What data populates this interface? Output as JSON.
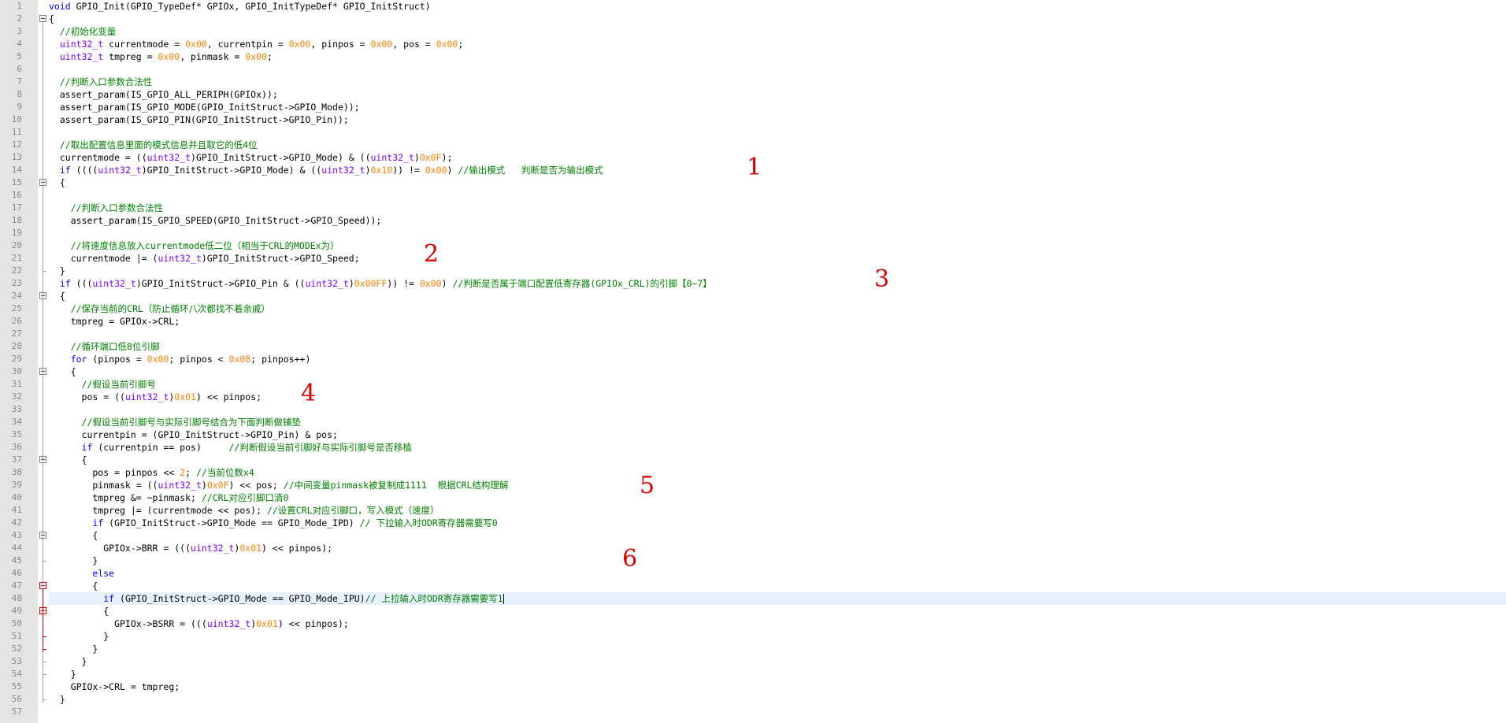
{
  "editor": {
    "lines": [
      {
        "n": "1",
        "html": "<span class=\"kw\">void</span> GPIO_Init(GPIO_TypeDef* GPIOx, GPIO_InitTypeDef* GPIO_InitStruct)"
      },
      {
        "n": "2",
        "html": "{"
      },
      {
        "n": "3",
        "html": "  <span class=\"cm\">//初始化变量</span>"
      },
      {
        "n": "4",
        "html": "  <span class=\"ty\">uint32_t</span> currentmode = <span class=\"num\">0x00</span>, currentpin = <span class=\"num\">0x00</span>, pinpos = <span class=\"num\">0x00</span>, pos = <span class=\"num\">0x00</span>;"
      },
      {
        "n": "5",
        "html": "  <span class=\"ty\">uint32_t</span> tmpreg = <span class=\"num\">0x00</span>, pinmask = <span class=\"num\">0x00</span>;"
      },
      {
        "n": "6",
        "html": ""
      },
      {
        "n": "7",
        "html": "  <span class=\"cm\">//判断入口参数合法性</span>"
      },
      {
        "n": "8",
        "html": "  assert_param(IS_GPIO_ALL_PERIPH(GPIOx));"
      },
      {
        "n": "9",
        "html": "  assert_param(IS_GPIO_MODE(GPIO_InitStruct-&gt;GPIO_Mode));"
      },
      {
        "n": "10",
        "html": "  assert_param(IS_GPIO_PIN(GPIO_InitStruct-&gt;GPIO_Pin));"
      },
      {
        "n": "11",
        "html": ""
      },
      {
        "n": "12",
        "html": "  <span class=\"cm\">//取出配置信息里面的模式信息并且取它的低4位</span>"
      },
      {
        "n": "13",
        "html": "  currentmode = ((<span class=\"ty\">uint32_t</span>)GPIO_InitStruct-&gt;GPIO_Mode) &amp; ((<span class=\"ty\">uint32_t</span>)<span class=\"num\">0x0F</span>);"
      },
      {
        "n": "14",
        "html": "  <span class=\"kw\">if</span> ((((<span class=\"ty\">uint32_t</span>)GPIO_InitStruct-&gt;GPIO_Mode) &amp; ((<span class=\"ty\">uint32_t</span>)<span class=\"num\">0x10</span>)) != <span class=\"num\">0x00</span>) <span class=\"cm\">//输出模式   判断是否为输出模式</span>"
      },
      {
        "n": "15",
        "html": "  {"
      },
      {
        "n": "16",
        "html": ""
      },
      {
        "n": "17",
        "html": "    <span class=\"cm\">//判断入口参数合法性</span>"
      },
      {
        "n": "18",
        "html": "    assert_param(IS_GPIO_SPEED(GPIO_InitStruct-&gt;GPIO_Speed));"
      },
      {
        "n": "19",
        "html": ""
      },
      {
        "n": "20",
        "html": "    <span class=\"cm\">//将速度信息放入currentmode低二位（相当于CRL的MODEx为）</span>"
      },
      {
        "n": "21",
        "html": "    currentmode |= (<span class=\"ty\">uint32_t</span>)GPIO_InitStruct-&gt;GPIO_Speed;"
      },
      {
        "n": "22",
        "html": "  }"
      },
      {
        "n": "23",
        "html": "  <span class=\"kw\">if</span> (((<span class=\"ty\">uint32_t</span>)GPIO_InitStruct-&gt;GPIO_Pin &amp; ((<span class=\"ty\">uint32_t</span>)<span class=\"num\">0x00FF</span>)) != <span class=\"num\">0x00</span>) <span class=\"cm\">//判断是否属于端口配置低寄存器(GPIOx_CRL)的引脚【0~7】</span>"
      },
      {
        "n": "24",
        "html": "  {"
      },
      {
        "n": "25",
        "html": "    <span class=\"cm\">//保存当前的CRL（防止循环八次都找不着亲戚）</span>"
      },
      {
        "n": "26",
        "html": "    tmpreg = GPIOx-&gt;CRL;"
      },
      {
        "n": "27",
        "html": ""
      },
      {
        "n": "28",
        "html": "    <span class=\"cm\">//循环端口低8位引脚</span>"
      },
      {
        "n": "29",
        "html": "    <span class=\"kw\">for</span> (pinpos = <span class=\"num\">0x00</span>; pinpos &lt; <span class=\"num\">0x08</span>; pinpos++)"
      },
      {
        "n": "30",
        "html": "    {"
      },
      {
        "n": "31",
        "html": "      <span class=\"cm\">//假设当前引脚号</span>"
      },
      {
        "n": "32",
        "html": "      pos = ((<span class=\"ty\">uint32_t</span>)<span class=\"num\">0x01</span>) &lt;&lt; pinpos;"
      },
      {
        "n": "33",
        "html": ""
      },
      {
        "n": "34",
        "html": "      <span class=\"cm\">//假设当前引脚号与实际引脚号结合为下面判断做铺垫</span>"
      },
      {
        "n": "35",
        "html": "      currentpin = (GPIO_InitStruct-&gt;GPIO_Pin) &amp; pos;"
      },
      {
        "n": "36",
        "html": "      <span class=\"kw\">if</span> (currentpin == pos)     <span class=\"cm\">//判断假设当前引脚好与实际引脚号是否移植</span>"
      },
      {
        "n": "37",
        "html": "      {"
      },
      {
        "n": "38",
        "html": "        pos = pinpos &lt;&lt; <span class=\"num\">2</span>; <span class=\"cm\">//当前位数x4</span>"
      },
      {
        "n": "39",
        "html": "        pinmask = ((<span class=\"ty\">uint32_t</span>)<span class=\"num\">0x0F</span>) &lt;&lt; pos; <span class=\"cm\">//中间变量pinmask被复制成1111  根据CRL结构理解</span>"
      },
      {
        "n": "40",
        "html": "        tmpreg &amp;= ~pinmask; <span class=\"cm\">//CRL对应引脚口清0</span>"
      },
      {
        "n": "41",
        "html": "        tmpreg |= (currentmode &lt;&lt; pos); <span class=\"cm\">//设置CRL对应引脚口，写入模式（速度）</span>"
      },
      {
        "n": "42",
        "html": "        <span class=\"kw\">if</span> (GPIO_InitStruct-&gt;GPIO_Mode == GPIO_Mode_IPD) <span class=\"cm\">// 下拉输入时ODR寄存器需要写0</span>"
      },
      {
        "n": "43",
        "html": "        {"
      },
      {
        "n": "44",
        "html": "          GPIOx-&gt;BRR = (((<span class=\"ty\">uint32_t</span>)<span class=\"num\">0x01</span>) &lt;&lt; pinpos);"
      },
      {
        "n": "45",
        "html": "        }"
      },
      {
        "n": "46",
        "html": "        <span class=\"kw\">else</span>"
      },
      {
        "n": "47",
        "html": "        {"
      },
      {
        "n": "48",
        "html": "          <span class=\"kw\">if</span> (GPIO_InitStruct-&gt;GPIO_Mode == GPIO_Mode_IPU)<span class=\"cm\">// 上拉输入时ODR寄存器需要写1</span><span class=\"caret\"></span>"
      },
      {
        "n": "49",
        "html": "          {"
      },
      {
        "n": "50",
        "html": "            GPIOx-&gt;BSRR = (((<span class=\"ty\">uint32_t</span>)<span class=\"num\">0x01</span>) &lt;&lt; pinpos);"
      },
      {
        "n": "51",
        "html": "          }"
      },
      {
        "n": "52",
        "html": "        }"
      },
      {
        "n": "53",
        "html": "      }"
      },
      {
        "n": "54",
        "html": "    }"
      },
      {
        "n": "55",
        "html": "    GPIOx-&gt;CRL = tmpreg;"
      },
      {
        "n": "56",
        "html": "  }"
      },
      {
        "n": "57",
        "html": ""
      }
    ]
  },
  "annotations": [
    {
      "label": "1"
    },
    {
      "label": "2"
    },
    {
      "label": "3"
    },
    {
      "label": "4"
    },
    {
      "label": "5"
    },
    {
      "label": "6"
    }
  ]
}
